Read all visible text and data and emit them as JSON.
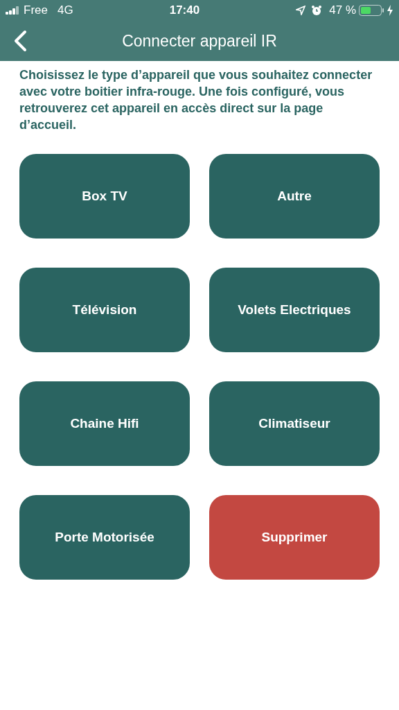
{
  "status_bar": {
    "carrier": "Free",
    "network": "4G",
    "time": "17:40",
    "battery": "47 %"
  },
  "header": {
    "title": "Connecter appareil IR"
  },
  "intro": "Choisissez le type d’appareil que vous souhaitez connecter avec votre boitier infra-rouge. Une fois configuré, vous retrouverez cet appareil en accès direct sur la page d’accueil.",
  "buttons": [
    {
      "label": "Box TV",
      "kind": "device"
    },
    {
      "label": "Autre",
      "kind": "device"
    },
    {
      "label": "Télévision",
      "kind": "device"
    },
    {
      "label": "Volets Electriques",
      "kind": "device"
    },
    {
      "label": "Chaine Hifi",
      "kind": "device"
    },
    {
      "label": "Climatiseur",
      "kind": "device"
    },
    {
      "label": "Porte Motorisée",
      "kind": "device"
    },
    {
      "label": "Supprimer",
      "kind": "danger"
    }
  ]
}
